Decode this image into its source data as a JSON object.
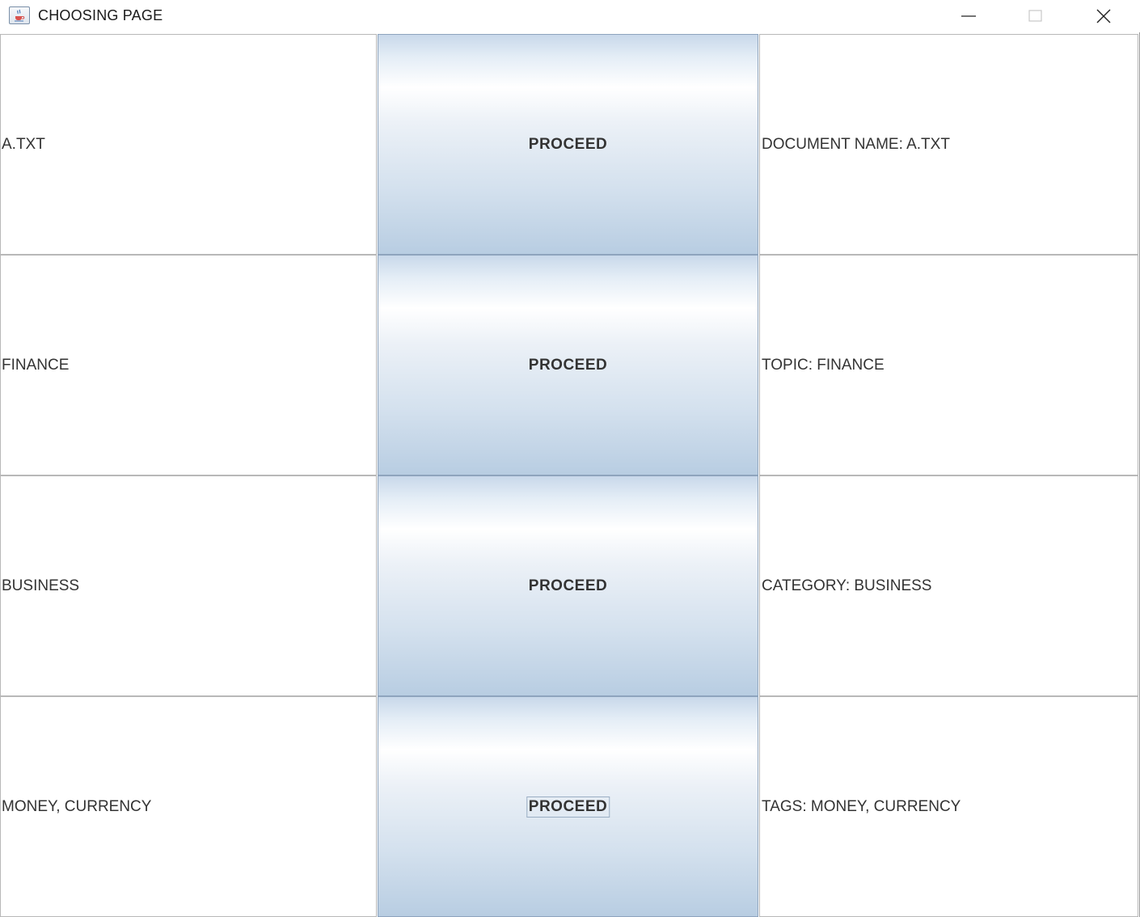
{
  "window": {
    "title": "CHOOSING PAGE",
    "app_icon": "java-cup-icon",
    "controls": [
      "minimize-icon",
      "maximize-icon",
      "close-icon"
    ]
  },
  "rows": [
    {
      "left_label": "A.TXT",
      "button_label": "PROCEED",
      "right_label": "DOCUMENT NAME: A.TXT"
    },
    {
      "left_label": "FINANCE",
      "button_label": "PROCEED",
      "right_label": "TOPIC: FINANCE"
    },
    {
      "left_label": "BUSINESS",
      "button_label": "PROCEED",
      "right_label": "CATEGORY: BUSINESS"
    },
    {
      "left_label": "MONEY, CURRENCY",
      "button_label": "PROCEED",
      "right_label": "TAGS: MONEY, CURRENCY",
      "focused": true
    }
  ],
  "colors": {
    "button_top": "#c8d8ea",
    "button_bottom": "#b8cde2",
    "text": "#333333",
    "cell_border": "#b8b8b8"
  }
}
